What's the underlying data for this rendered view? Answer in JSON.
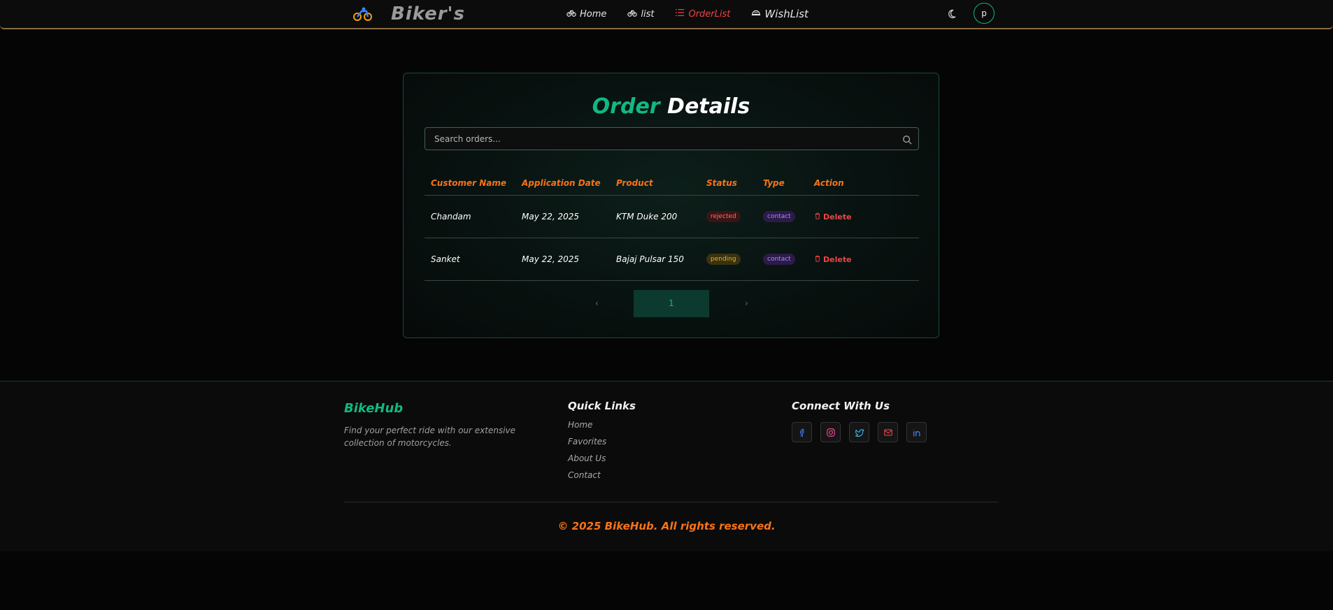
{
  "navbar": {
    "brand": "Biker's",
    "links": [
      {
        "label": "Home",
        "icon": "bike-icon"
      },
      {
        "label": "list",
        "icon": "bike-icon"
      },
      {
        "label": "OrderList",
        "icon": "list-icon",
        "active": true
      },
      {
        "label": "WishList",
        "icon": "helmet-icon"
      }
    ],
    "avatar_initial": "p"
  },
  "orders": {
    "title_part1": "Order",
    "title_part2": "Details",
    "search_placeholder": "Search orders...",
    "columns": [
      "Customer Name",
      "Application Date",
      "Product",
      "Status",
      "Type",
      "Action"
    ],
    "rows": [
      {
        "customer": "Chandam",
        "date": "May 22, 2025",
        "product": "KTM Duke 200",
        "status": "rejected",
        "type": "contact",
        "action": "Delete"
      },
      {
        "customer": "Sanket",
        "date": "May 22, 2025",
        "product": "Bajaj Pulsar 150",
        "status": "pending",
        "type": "contact",
        "action": "Delete"
      }
    ],
    "pagination": {
      "prev": "‹",
      "page": "1",
      "next": "›"
    }
  },
  "footer": {
    "brand": "BikeHub",
    "description": "Find your perfect ride with our extensive collection of motorcycles.",
    "quick_links_title": "Quick Links",
    "quick_links": [
      "Home",
      "Favorites",
      "About Us",
      "Contact"
    ],
    "connect_title": "Connect With Us",
    "socials": [
      "facebook-icon",
      "instagram-icon",
      "twitter-icon",
      "mail-icon",
      "linkedin-icon"
    ],
    "copyright": "© 2025 BikeHub. All rights reserved."
  },
  "colors": {
    "accent_green": "#10b981",
    "accent_orange": "#f97316",
    "active_red": "#ef4444",
    "background": "#050505"
  }
}
